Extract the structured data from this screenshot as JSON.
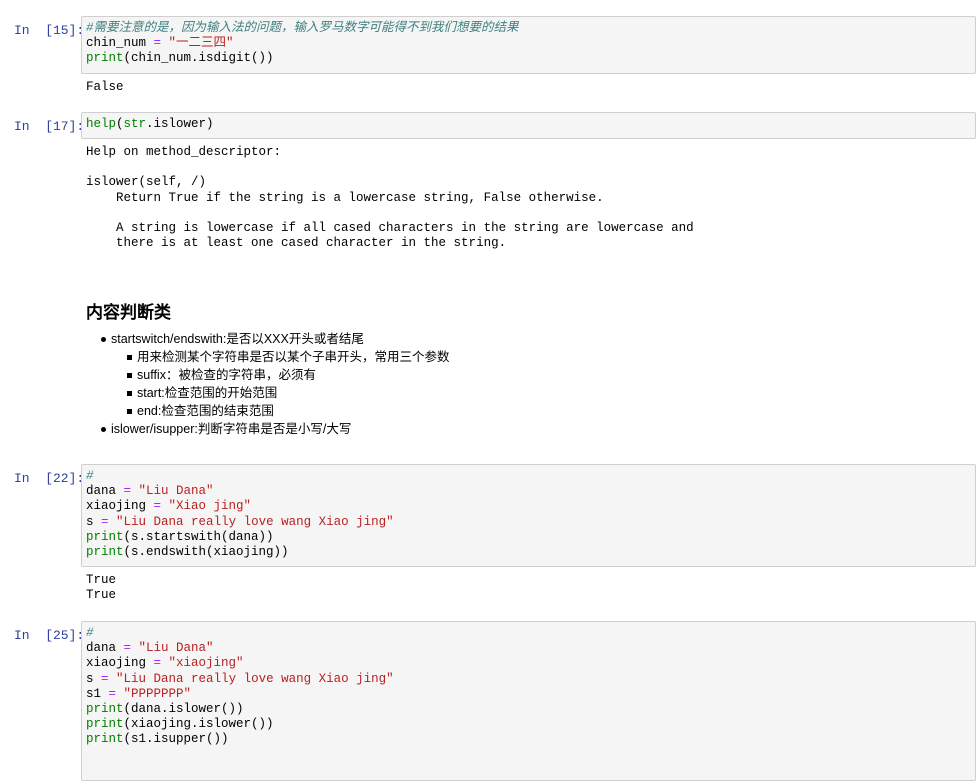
{
  "cells": [
    {
      "prompt": "In  [15]:",
      "lines": [
        [
          {
            "t": "#需要注意的是，因为输入法的问题，输入罗马数字可能得不到我们想要的结果",
            "c": "comment"
          }
        ],
        [
          {
            "t": "chin_num ",
            "c": ""
          },
          {
            "t": "=",
            "c": "op"
          },
          {
            "t": " ",
            "c": ""
          },
          {
            "t": "\"一二三四\"",
            "c": "string"
          }
        ],
        [
          {
            "t": "print",
            "c": "builtin"
          },
          {
            "t": "(chin_num.isdigit())",
            "c": ""
          }
        ]
      ],
      "output": "False"
    },
    {
      "prompt": "In  [17]:",
      "lines": [
        [
          {
            "t": "help",
            "c": "builtin"
          },
          {
            "t": "(",
            "c": ""
          },
          {
            "t": "str",
            "c": "builtin"
          },
          {
            "t": ".islower)",
            "c": ""
          }
        ]
      ],
      "output": "Help on method_descriptor:\n\nislower(self, /)\n    Return True if the string is a lowercase string, False otherwise.\n\n    A string is lowercase if all cased characters in the string are lowercase and\n    there is at least one cased character in the string."
    },
    {
      "prompt": "In  [22]:",
      "lines": [
        [
          {
            "t": "#",
            "c": "comment"
          }
        ],
        [
          {
            "t": "dana ",
            "c": ""
          },
          {
            "t": "=",
            "c": "op"
          },
          {
            "t": " ",
            "c": ""
          },
          {
            "t": "\"Liu Dana\"",
            "c": "string"
          }
        ],
        [
          {
            "t": "xiaojing ",
            "c": ""
          },
          {
            "t": "=",
            "c": "op"
          },
          {
            "t": " ",
            "c": ""
          },
          {
            "t": "\"Xiao jing\"",
            "c": "string"
          }
        ],
        [
          {
            "t": "s ",
            "c": ""
          },
          {
            "t": "=",
            "c": "op"
          },
          {
            "t": " ",
            "c": ""
          },
          {
            "t": "\"Liu Dana really love wang Xiao jing\"",
            "c": "string"
          }
        ],
        [
          {
            "t": "print",
            "c": "builtin"
          },
          {
            "t": "(s.startswith(dana))",
            "c": ""
          }
        ],
        [
          {
            "t": "print",
            "c": "builtin"
          },
          {
            "t": "(s.endswith(xiaojing))",
            "c": ""
          }
        ]
      ],
      "output": "True\nTrue"
    },
    {
      "prompt": "In  [25]:",
      "lines": [
        [
          {
            "t": "#",
            "c": "comment"
          }
        ],
        [
          {
            "t": "dana ",
            "c": ""
          },
          {
            "t": "=",
            "c": "op"
          },
          {
            "t": " ",
            "c": ""
          },
          {
            "t": "\"Liu Dana\"",
            "c": "string"
          }
        ],
        [
          {
            "t": "xiaojing ",
            "c": ""
          },
          {
            "t": "=",
            "c": "op"
          },
          {
            "t": " ",
            "c": ""
          },
          {
            "t": "\"xiaojing\"",
            "c": "string"
          }
        ],
        [
          {
            "t": "s ",
            "c": ""
          },
          {
            "t": "=",
            "c": "op"
          },
          {
            "t": " ",
            "c": ""
          },
          {
            "t": "\"Liu Dana really love wang Xiao jing\"",
            "c": "string"
          }
        ],
        [
          {
            "t": "s1 ",
            "c": ""
          },
          {
            "t": "=",
            "c": "op"
          },
          {
            "t": " ",
            "c": ""
          },
          {
            "t": "\"PPPPPPP\"",
            "c": "string"
          }
        ],
        [
          {
            "t": "print",
            "c": "builtin"
          },
          {
            "t": "(dana.islower())",
            "c": ""
          }
        ],
        [
          {
            "t": "print",
            "c": "builtin"
          },
          {
            "t": "(xiaojing.islower())",
            "c": ""
          }
        ],
        [
          {
            "t": "print",
            "c": "builtin"
          },
          {
            "t": "(s1.isupper())",
            "c": ""
          }
        ]
      ],
      "output": ""
    }
  ],
  "markdown": {
    "heading": "内容判断类",
    "items": [
      {
        "level": 1,
        "text": "startswitch/endswith:是否以XXX开头或者结尾"
      },
      {
        "level": 2,
        "text": "用来检测某个字符串是否以某个子串开头，常用三个参数"
      },
      {
        "level": 2,
        "text": "suffix：被检查的字符串，必须有"
      },
      {
        "level": 2,
        "text": "start:检查范围的开始范围"
      },
      {
        "level": 2,
        "text": "end:检查范围的结束范围"
      },
      {
        "level": 1,
        "text": "islower/isupper:判断字符串是否是小写/大写"
      }
    ]
  },
  "colors": {
    "prompt": "#303f9f",
    "comment": "#408080",
    "string": "#ba2121",
    "builtin": "#008000",
    "operator": "#aa22ff",
    "cell_background": "#f5f5f5",
    "cell_border": "#cfcfcf"
  }
}
